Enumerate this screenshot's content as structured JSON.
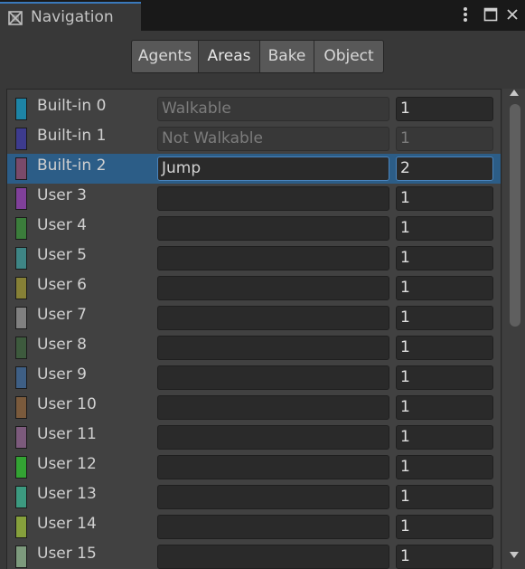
{
  "window": {
    "title": "Navigation",
    "tab_icon": "navmesh-grid-icon",
    "controls": [
      "kebab-menu-icon",
      "maximize-icon",
      "close-icon"
    ]
  },
  "tabs": [
    {
      "label": "Agents",
      "active": false
    },
    {
      "label": "Areas",
      "active": true
    },
    {
      "label": "Bake",
      "active": false
    },
    {
      "label": "Object",
      "active": false
    }
  ],
  "areas": [
    {
      "label": "Built-in 0",
      "name": "Walkable",
      "cost": "1",
      "color": "#1d84a6",
      "name_disabled": true,
      "cost_disabled": false,
      "selected": false
    },
    {
      "label": "Built-in 1",
      "name": "Not Walkable",
      "cost": "1",
      "color": "#3d3b8e",
      "name_disabled": true,
      "cost_disabled": true,
      "selected": false
    },
    {
      "label": "Built-in 2",
      "name": "Jump",
      "cost": "2",
      "color": "#7a4a6a",
      "name_disabled": false,
      "cost_disabled": false,
      "selected": true
    },
    {
      "label": "User 3",
      "name": "",
      "cost": "1",
      "color": "#80409a",
      "name_disabled": false,
      "cost_disabled": false,
      "selected": false
    },
    {
      "label": "User 4",
      "name": "",
      "cost": "1",
      "color": "#3b7d3b",
      "name_disabled": false,
      "cost_disabled": false,
      "selected": false
    },
    {
      "label": "User 5",
      "name": "",
      "cost": "1",
      "color": "#3e8585",
      "name_disabled": false,
      "cost_disabled": false,
      "selected": false
    },
    {
      "label": "User 6",
      "name": "",
      "cost": "1",
      "color": "#868036",
      "name_disabled": false,
      "cost_disabled": false,
      "selected": false
    },
    {
      "label": "User 7",
      "name": "",
      "cost": "1",
      "color": "#808080",
      "name_disabled": false,
      "cost_disabled": false,
      "selected": false
    },
    {
      "label": "User 8",
      "name": "",
      "cost": "1",
      "color": "#3d5a3d",
      "name_disabled": false,
      "cost_disabled": false,
      "selected": false
    },
    {
      "label": "User 9",
      "name": "",
      "cost": "1",
      "color": "#3e5f85",
      "name_disabled": false,
      "cost_disabled": false,
      "selected": false
    },
    {
      "label": "User 10",
      "name": "",
      "cost": "1",
      "color": "#7a5a3c",
      "name_disabled": false,
      "cost_disabled": false,
      "selected": false
    },
    {
      "label": "User 11",
      "name": "",
      "cost": "1",
      "color": "#7c5a7c",
      "name_disabled": false,
      "cost_disabled": false,
      "selected": false
    },
    {
      "label": "User 12",
      "name": "",
      "cost": "1",
      "color": "#33a333",
      "name_disabled": false,
      "cost_disabled": false,
      "selected": false
    },
    {
      "label": "User 13",
      "name": "",
      "cost": "1",
      "color": "#3c9a80",
      "name_disabled": false,
      "cost_disabled": false,
      "selected": false
    },
    {
      "label": "User 14",
      "name": "",
      "cost": "1",
      "color": "#86a03c",
      "name_disabled": false,
      "cost_disabled": false,
      "selected": false
    },
    {
      "label": "User 15",
      "name": "",
      "cost": "1",
      "color": "#7d9a7d",
      "name_disabled": false,
      "cost_disabled": false,
      "selected": false
    }
  ],
  "scrollbar": {
    "up_icon": "scroll-up-arrow-icon",
    "down_icon": "scroll-down-arrow-icon"
  }
}
